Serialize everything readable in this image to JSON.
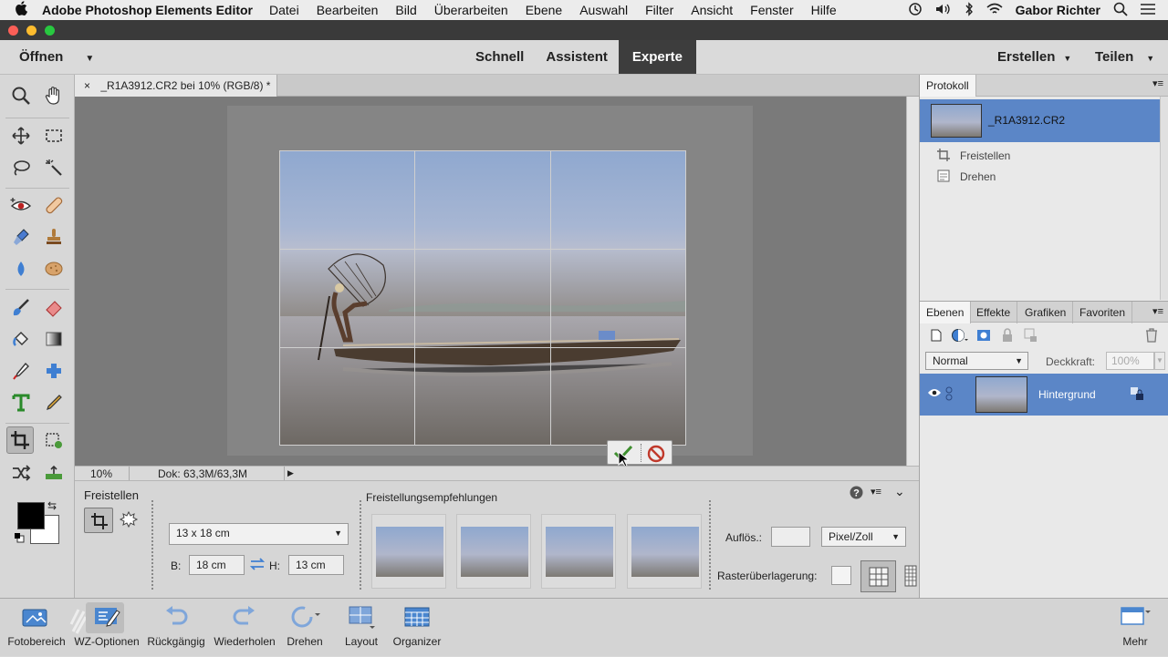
{
  "menubar": {
    "apple": "",
    "app_name": "Adobe Photoshop Elements Editor",
    "items": [
      "Datei",
      "Bearbeiten",
      "Bild",
      "Überarbeiten",
      "Ebene",
      "Auswahl",
      "Filter",
      "Ansicht",
      "Fenster",
      "Hilfe"
    ],
    "user": "Gabor Richter"
  },
  "modebar": {
    "open_label": "Öffnen",
    "modes": [
      "Schnell",
      "Assistent",
      "Experte"
    ],
    "active_mode": "Experte",
    "create_label": "Erstellen",
    "share_label": "Teilen"
  },
  "document": {
    "tab_close": "×",
    "tab_title": "_R1A3912.CR2 bei 10% (RGB/8) *",
    "zoom": "10%",
    "doc_size": "Dok: 63,3M/63,3M"
  },
  "protocol": {
    "tab": "Protokoll",
    "snapshot_name": "_R1A3912.CR2",
    "entries": [
      "Freistellen",
      "Drehen"
    ]
  },
  "layers": {
    "tabs": [
      "Ebenen",
      "Effekte",
      "Grafiken",
      "Favoriten"
    ],
    "blend_mode": "Normal",
    "opacity_label": "Deckkraft:",
    "opacity_value": "100%",
    "layer_name": "Hintergrund"
  },
  "options": {
    "tool_name": "Freistellen",
    "preset": "13 x 18 cm",
    "width_label": "B:",
    "width_value": "18 cm",
    "height_label": "H:",
    "height_value": "13 cm",
    "recommendations_title": "Freistellungsempfehlungen",
    "resolution_label": "Auflös.:",
    "resolution_value": "",
    "unit": "Pixel/Zoll",
    "grid_overlay_label": "Rasterüberlagerung:"
  },
  "bottombar": {
    "items": [
      "Fotobereich",
      "WZ-Optionen",
      "Rückgängig",
      "Wiederholen",
      "Drehen",
      "Layout",
      "Organizer"
    ],
    "more": "Mehr"
  },
  "colors": {
    "accent_selection": "#5b86c7",
    "active_mode_bg": "#3d3d3d",
    "commit_green": "#3f8f2f",
    "cancel_red": "#c0392b"
  }
}
